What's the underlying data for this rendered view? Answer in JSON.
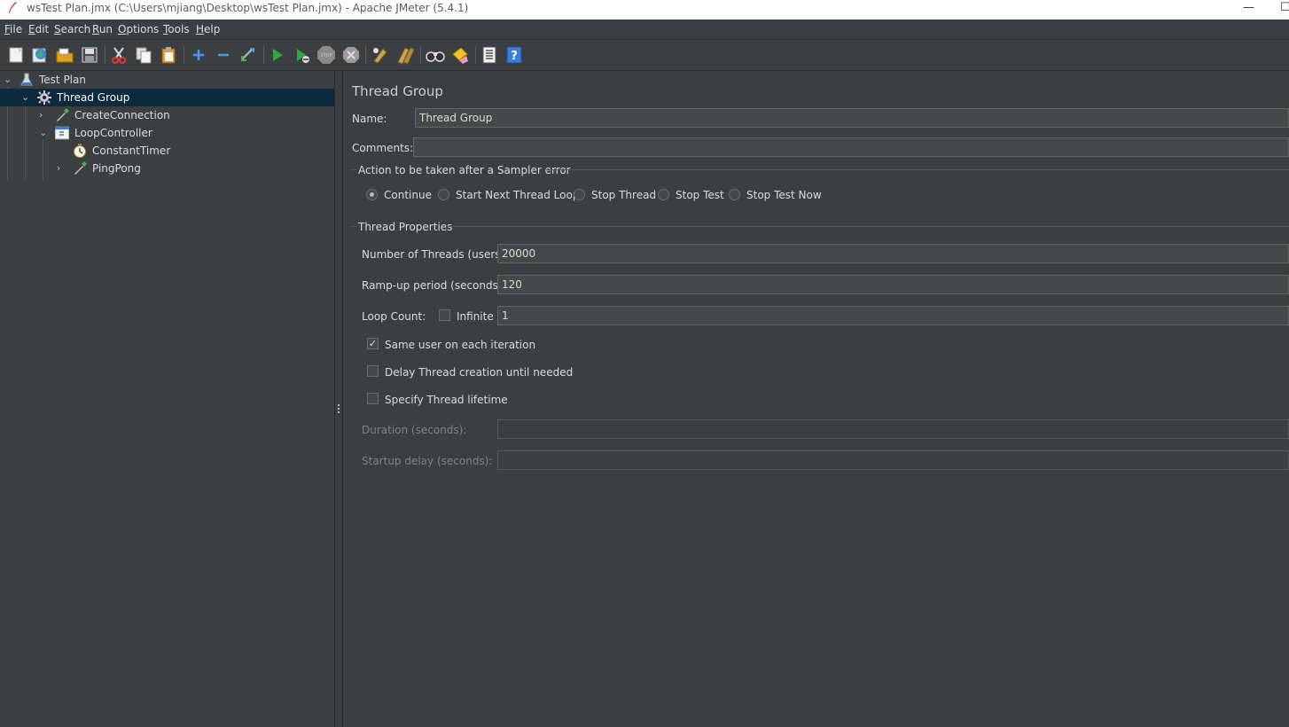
{
  "window": {
    "title": "wsTest Plan.jmx (C:\\Users\\mjiang\\Desktop\\wsTest Plan.jmx) - Apache JMeter (5.4.1)",
    "minimize": "—",
    "maximize": "☐"
  },
  "menu": {
    "file": {
      "key": "F",
      "rest": "ile"
    },
    "edit": {
      "key": "E",
      "rest": "dit"
    },
    "search": {
      "key": "S",
      "rest": "earch"
    },
    "run": {
      "key": "R",
      "rest": "un"
    },
    "options": {
      "key": "O",
      "rest": "ptions"
    },
    "tools": {
      "key": "T",
      "rest": "ools"
    },
    "help": {
      "key": "H",
      "rest": "elp"
    }
  },
  "toolbar": {
    "icons": [
      "new-icon",
      "templates-icon",
      "open-icon",
      "save-icon",
      "cut-icon",
      "copy-icon",
      "paste-icon",
      "expand-icon",
      "collapse-icon",
      "toggle-icon",
      "start-icon",
      "start-no-pause-icon",
      "stop-icon",
      "shutdown-icon",
      "clear-icon",
      "clear-all-icon",
      "search-icon",
      "reset-search-icon",
      "function-helper-icon",
      "help-icon"
    ]
  },
  "tree": {
    "test_plan": "Test Plan",
    "thread_group": "Thread Group",
    "create_connection": "CreateConnection",
    "loop_controller": "LoopController",
    "constant_timer": "ConstantTimer",
    "ping_pong": "PingPong",
    "selected": "Thread Group",
    "selection_color": "#0d293e"
  },
  "panel": {
    "title": "Thread Group",
    "name_label": "Name:",
    "name_value": "Thread Group",
    "comments_label": "Comments:",
    "comments_value": "",
    "error_action": {
      "legend": "Action to be taken after a Sampler error",
      "options": [
        "Continue",
        "Start Next Thread Loop",
        "Stop Thread",
        "Stop Test",
        "Stop Test Now"
      ],
      "selected": "Continue"
    },
    "thread_properties": {
      "legend": "Thread Properties",
      "threads_label": "Number of Threads (users):",
      "threads_value": "20000",
      "rampup_label": "Ramp-up period (seconds):",
      "rampup_value": "120",
      "loop_label": "Loop Count:",
      "infinite_label": "Infinite",
      "infinite_checked": false,
      "loop_value": "1",
      "same_user_label": "Same user on each iteration",
      "same_user_checked": true,
      "delay_label": "Delay Thread creation until needed",
      "delay_checked": false,
      "lifetime_label": "Specify Thread lifetime",
      "lifetime_checked": false,
      "duration_label": "Duration (seconds):",
      "duration_value": "",
      "startup_label": "Startup delay (seconds):",
      "startup_value": ""
    }
  }
}
